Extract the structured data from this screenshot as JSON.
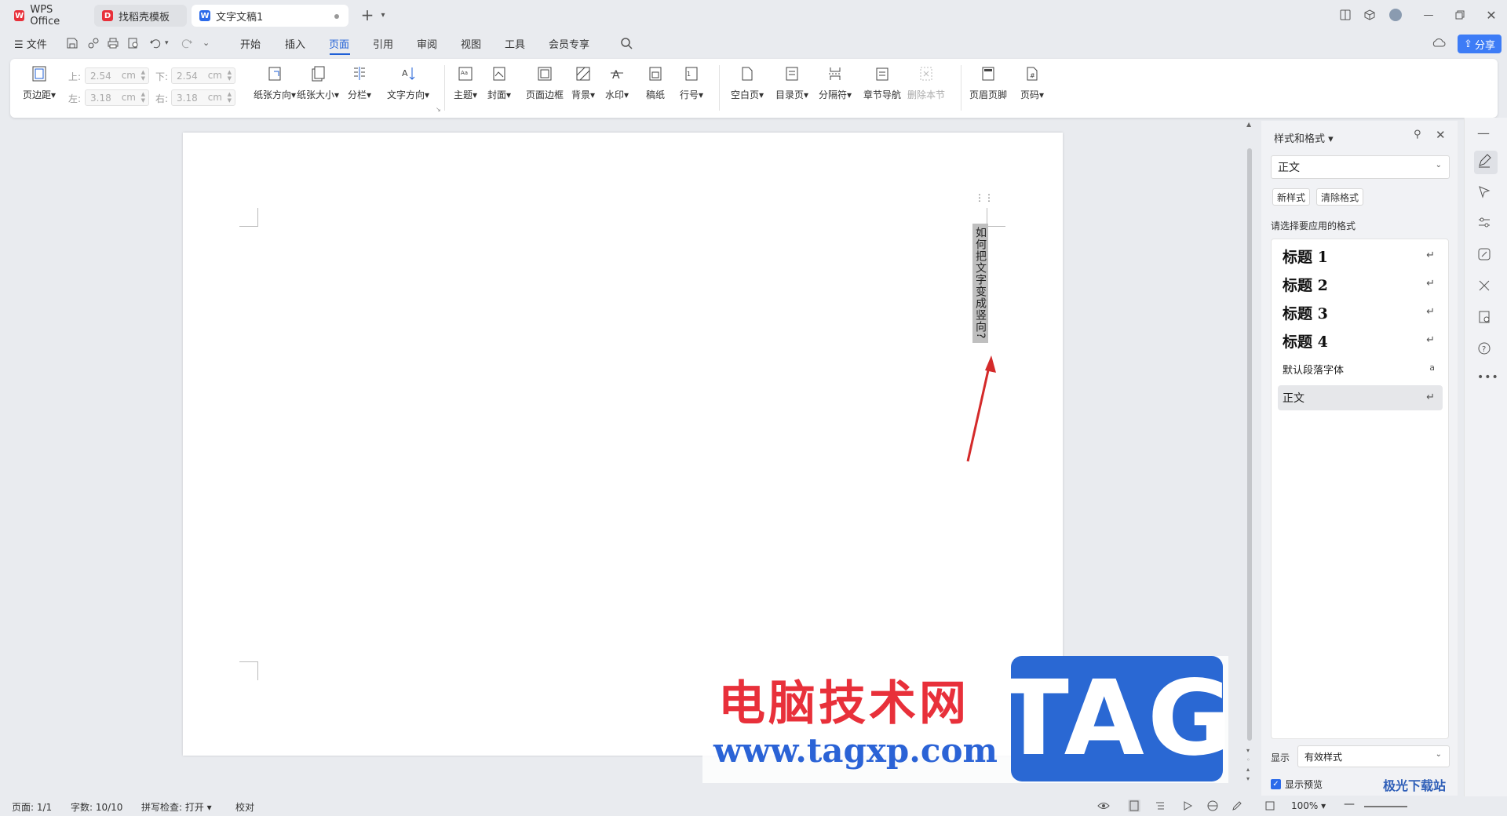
{
  "tabs": [
    {
      "label": "WPS Office",
      "icon": "wps-logo-icon"
    },
    {
      "label": "找稻壳模板",
      "icon": "docer-icon"
    },
    {
      "label": "文字文稿1",
      "icon": "writer-doc-icon"
    }
  ],
  "menu": {
    "file": "文件",
    "items": [
      "开始",
      "插入",
      "页面",
      "引用",
      "审阅",
      "视图",
      "工具",
      "会员专享"
    ],
    "active": "页面",
    "share": "分享"
  },
  "ribbon": {
    "margins": {
      "label": "页边距"
    },
    "margin_fields": {
      "top_label": "上:",
      "top_value": "2.54",
      "bottom_label": "下:",
      "bottom_value": "2.54",
      "left_label": "左:",
      "left_value": "3.18",
      "right_label": "右:",
      "right_value": "3.18",
      "unit": "cm"
    },
    "buttons": [
      {
        "label": "纸张方向",
        "dd": true
      },
      {
        "label": "纸张大小",
        "dd": true
      },
      {
        "label": "分栏",
        "dd": true
      },
      {
        "label": "文字方向",
        "dd": true
      },
      {
        "label": "主题",
        "dd": true
      },
      {
        "label": "封面",
        "dd": true
      },
      {
        "label": "页面边框",
        "dd": false
      },
      {
        "label": "背景",
        "dd": true
      },
      {
        "label": "水印",
        "dd": true
      },
      {
        "label": "稿纸",
        "dd": false
      },
      {
        "label": "行号",
        "dd": true
      },
      {
        "label": "空白页",
        "dd": true
      },
      {
        "label": "目录页",
        "dd": true
      },
      {
        "label": "分隔符",
        "dd": true
      },
      {
        "label": "章节导航",
        "dd": false
      },
      {
        "label": "删除本节",
        "dd": false,
        "disabled": true
      },
      {
        "label": "页眉页脚",
        "dd": false
      },
      {
        "label": "页码",
        "dd": true
      }
    ]
  },
  "document": {
    "vertical_text": "如何把文字变成竖向?"
  },
  "panel": {
    "title": "样式和格式",
    "current_style": "正文",
    "new_style": "新样式",
    "clear_format": "清除格式",
    "prompt": "请选择要应用的格式",
    "styles": [
      "标题 1",
      "标题 2",
      "标题 3",
      "标题 4",
      "默认段落字体",
      "正文"
    ],
    "selected_style": "正文",
    "show_label": "显示",
    "show_value": "有效样式",
    "preview_label": "显示预览",
    "preview_checked": true
  },
  "status": {
    "page": "页面: 1/1",
    "words": "字数: 10/10",
    "spell": "拼写检查: 打开",
    "proof": "校对",
    "zoom": "100%"
  },
  "watermark": {
    "cn": "电脑技术网",
    "url": "www.tagxp.com",
    "tag": "TAG",
    "site2": "极光下载站"
  },
  "colors": {
    "accent": "#1f5fd6",
    "share": "#3d7cf6",
    "arrow": "#d42a2a"
  }
}
